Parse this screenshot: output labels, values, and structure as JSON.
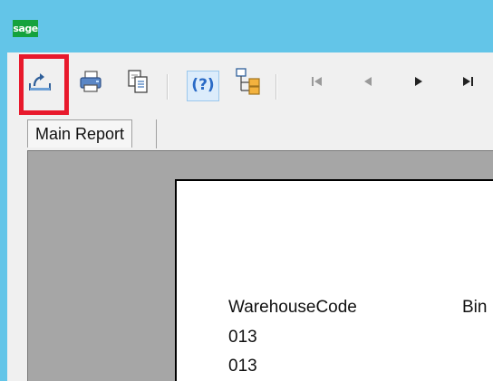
{
  "app": {
    "logo_text": "sage"
  },
  "toolbar": {
    "buttons": [
      {
        "name": "export",
        "icon": "export-icon"
      },
      {
        "name": "print",
        "icon": "printer-icon"
      },
      {
        "name": "copy",
        "icon": "copy-icon"
      },
      {
        "name": "help",
        "icon": "help-icon",
        "label": "(?)"
      },
      {
        "name": "group-tree",
        "icon": "group-tree-icon"
      },
      {
        "name": "first-page",
        "icon": "first-page-icon"
      },
      {
        "name": "previous-page",
        "icon": "previous-page-icon"
      },
      {
        "name": "next-page",
        "icon": "next-page-icon"
      },
      {
        "name": "last-page",
        "icon": "last-page-icon"
      }
    ],
    "highlight_color": "#e8192c"
  },
  "tabs": [
    {
      "label": "Main Report"
    }
  ],
  "report": {
    "columns": [
      "WarehouseCode",
      "Bin"
    ],
    "rows": [
      "013",
      "013"
    ]
  },
  "colors": {
    "titlebar": "#63c5e8",
    "logo": "#15a23c",
    "viewer_bg": "#a6a6a6"
  }
}
